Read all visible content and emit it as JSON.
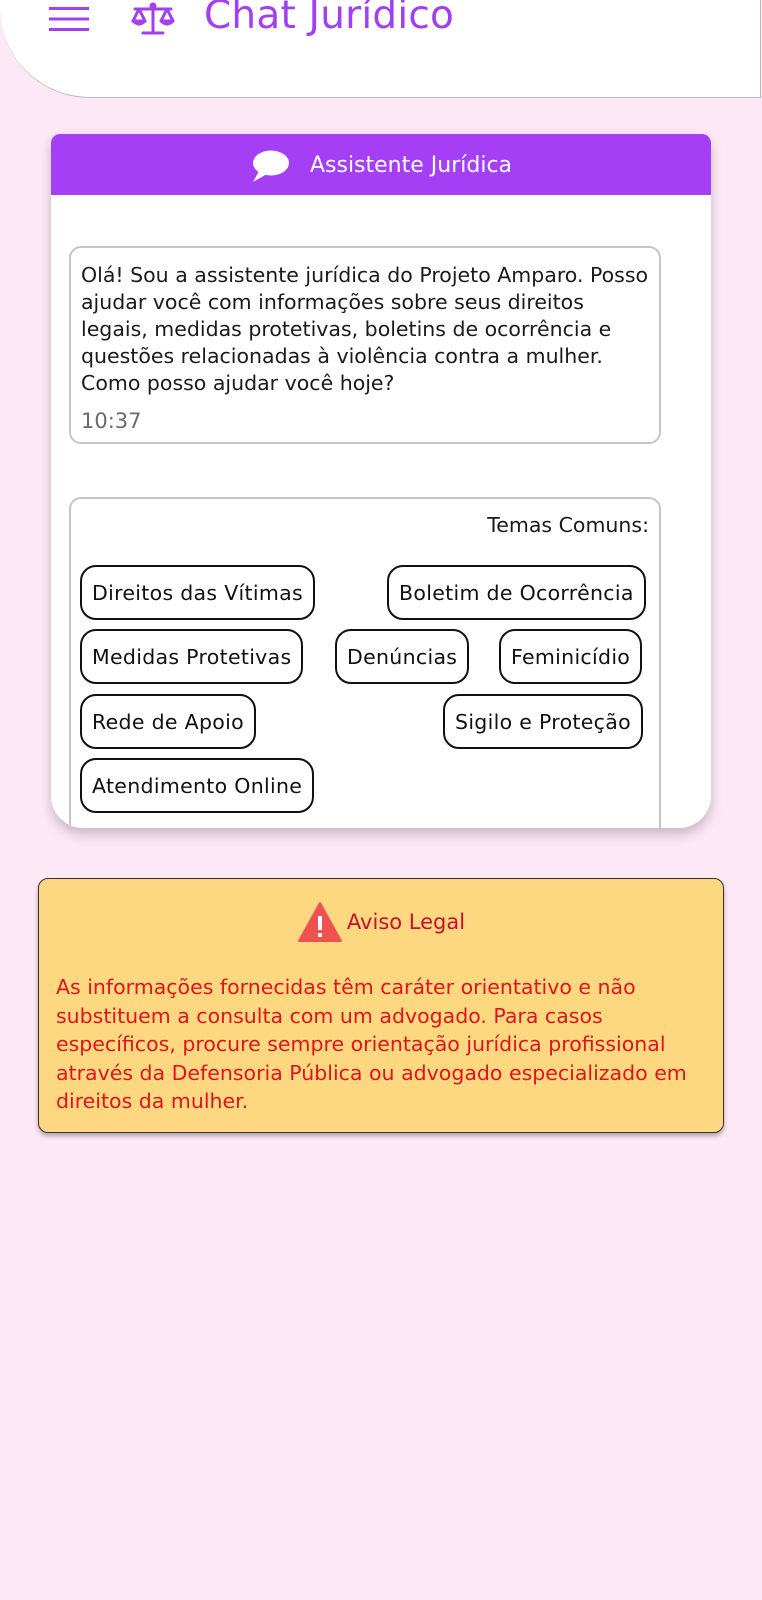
{
  "app_bar": {
    "title": "Chat Jurídico",
    "menu_icon": "hamburger-menu-icon",
    "title_icon": "scale-of-justice-icon",
    "accent_color": "#a23ff0"
  },
  "chat": {
    "header_title": "Assistente Jurídica",
    "header_icon": "chat-bubble-icon",
    "header_color": "#a43ff6",
    "message": {
      "text": "Olá! Sou a assistente jurídica do Projeto Amparo. Posso ajudar você com informações sobre seus direitos legais, medidas protetivas, boletins de ocorrência e questões relacionadas à violência contra a mulher. Como posso ajudar você hoje?",
      "time": "10:37"
    },
    "topics": {
      "title": "Temas Comuns:",
      "items": [
        "Direitos das Vítimas",
        "Boletim de Ocorrência",
        "Medidas Protetivas",
        "Denúncias",
        "Feminicídio",
        "Rede de Apoio",
        "Sigilo e Proteção",
        "Atendimento Online"
      ]
    }
  },
  "legal_notice": {
    "icon": "warning-triangle-icon",
    "title": "Aviso Legal",
    "text": "As informações fornecidas têm caráter orientativo e não substituem a consulta com um advogado. Para casos específicos, procure sempre orientação jurídica profissional através da Defensoria Pública ou advogado especializado em direitos da mulher.",
    "background_color": "#fdd880",
    "text_color": "#e0141c"
  },
  "page": {
    "background_color": "#fde9f6"
  }
}
